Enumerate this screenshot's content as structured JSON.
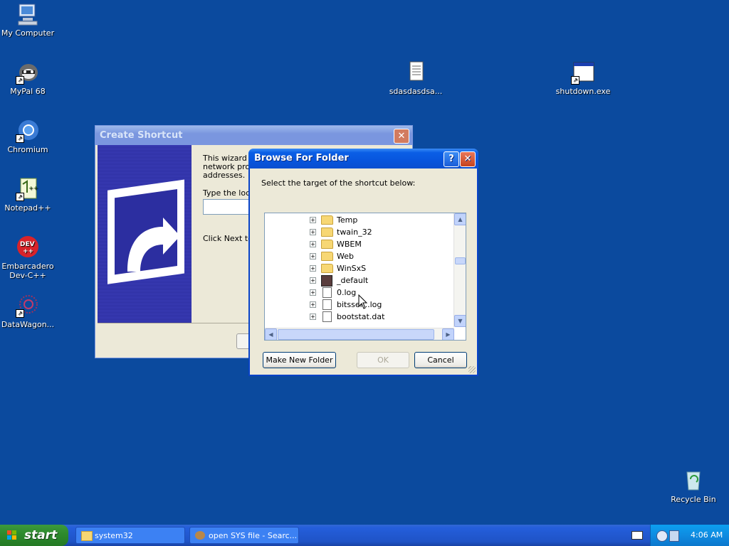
{
  "desktop": {
    "icons": [
      {
        "label": "My Computer"
      },
      {
        "label": "MyPal 68"
      },
      {
        "label": "Chromium"
      },
      {
        "label": "Notepad++"
      },
      {
        "label": "Embarcadero Dev-C++"
      },
      {
        "label": "DataWagon..."
      },
      {
        "label": "sdasdasdsa..."
      },
      {
        "label": "shutdown.exe"
      },
      {
        "label": "Recycle Bin"
      }
    ]
  },
  "create_shortcut": {
    "title": "Create Shortcut",
    "intro_line1": "This wizard he",
    "intro_line2": "network prog",
    "intro_line3": "addresses.",
    "location_label": "Type the loca",
    "next_text": "Click Next to c"
  },
  "browse_dialog": {
    "title": "Browse For Folder",
    "help_icon": "?",
    "close_icon": "✕",
    "instruction": "Select the target of the shortcut below:",
    "tree_items": [
      {
        "label": "Temp",
        "type": "folder"
      },
      {
        "label": "twain_32",
        "type": "folder"
      },
      {
        "label": "WBEM",
        "type": "folder"
      },
      {
        "label": "Web",
        "type": "folder"
      },
      {
        "label": "WinSxS",
        "type": "folder"
      },
      {
        "label": "_default",
        "type": "app"
      },
      {
        "label": "0.log",
        "type": "file"
      },
      {
        "label": "bitsser...log",
        "type": "file"
      },
      {
        "label": "bootstat.dat",
        "type": "file"
      }
    ],
    "make_new_folder": "Make New Folder",
    "ok": "OK",
    "cancel": "Cancel"
  },
  "taskbar": {
    "start_label": "start",
    "tasks": [
      {
        "label": "system32"
      },
      {
        "label": "open SYS file - Searc..."
      }
    ],
    "clock": "4:06 AM"
  }
}
